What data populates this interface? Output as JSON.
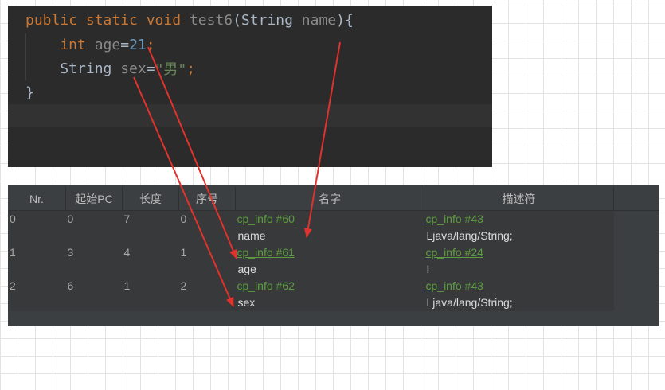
{
  "theme": {
    "editor_bg": "#2b2b2b",
    "current_line_bg": "#323232",
    "table_panel_bg": "#3c3f41",
    "table_header_bg": "#3c3f41",
    "table_header_text": "#bbbbbb",
    "table_row_bg": "#37393b",
    "table_text": "#a9a9a9",
    "table_value_text": "#dcdcdc",
    "annotation_arrow": "#e2322d"
  },
  "code_editor": {
    "lines": [
      {
        "tokens": [
          {
            "text": "public static void ",
            "color": "#cc7832"
          },
          {
            "text": "test6",
            "color": "#8a8a8a"
          },
          {
            "text": "(String ",
            "color": "#a9b7c6"
          },
          {
            "text": "name",
            "color": "#8a8a8a"
          },
          {
            "text": "){",
            "color": "#a9b7c6"
          }
        ]
      },
      {
        "tokens": [
          {
            "text": "int ",
            "color": "#cc7832"
          },
          {
            "text": "age",
            "color": "#8a8a8a"
          },
          {
            "text": "=",
            "color": "#a9b7c6"
          },
          {
            "text": "21",
            "color": "#6897bb"
          },
          {
            "text": ";",
            "color": "#cc7832"
          }
        ]
      },
      {
        "tokens": [
          {
            "text": "String ",
            "color": "#a9b7c6"
          },
          {
            "text": "sex",
            "color": "#8a8a8a"
          },
          {
            "text": "=",
            "color": "#a9b7c6"
          },
          {
            "text": "\"男\"",
            "color": "#6a8759"
          },
          {
            "text": ";",
            "color": "#cc7832"
          }
        ]
      },
      {
        "tokens": [
          {
            "text": "}",
            "color": "#a9b7c6"
          }
        ]
      }
    ]
  },
  "local_variable_table": {
    "headers": [
      "Nr.",
      "起始PC",
      "长度",
      "序号",
      "名字",
      "描述符"
    ],
    "link_color": "#5e9c3f",
    "rows": [
      {
        "nr": "0",
        "start_pc": "0",
        "length": "7",
        "index": "0",
        "name_ref": "cp_info #60",
        "name": "name",
        "descriptor_ref": "cp_info #43",
        "descriptor": "Ljava/lang/String;"
      },
      {
        "nr": "1",
        "start_pc": "3",
        "length": "4",
        "index": "1",
        "name_ref": "cp_info #61",
        "name": "age",
        "descriptor_ref": "cp_info #24",
        "descriptor": "I"
      },
      {
        "nr": "2",
        "start_pc": "6",
        "length": "1",
        "index": "2",
        "name_ref": "cp_info #62",
        "name": "sex",
        "descriptor_ref": "cp_info #43",
        "descriptor": "Ljava/lang/String;"
      }
    ]
  }
}
